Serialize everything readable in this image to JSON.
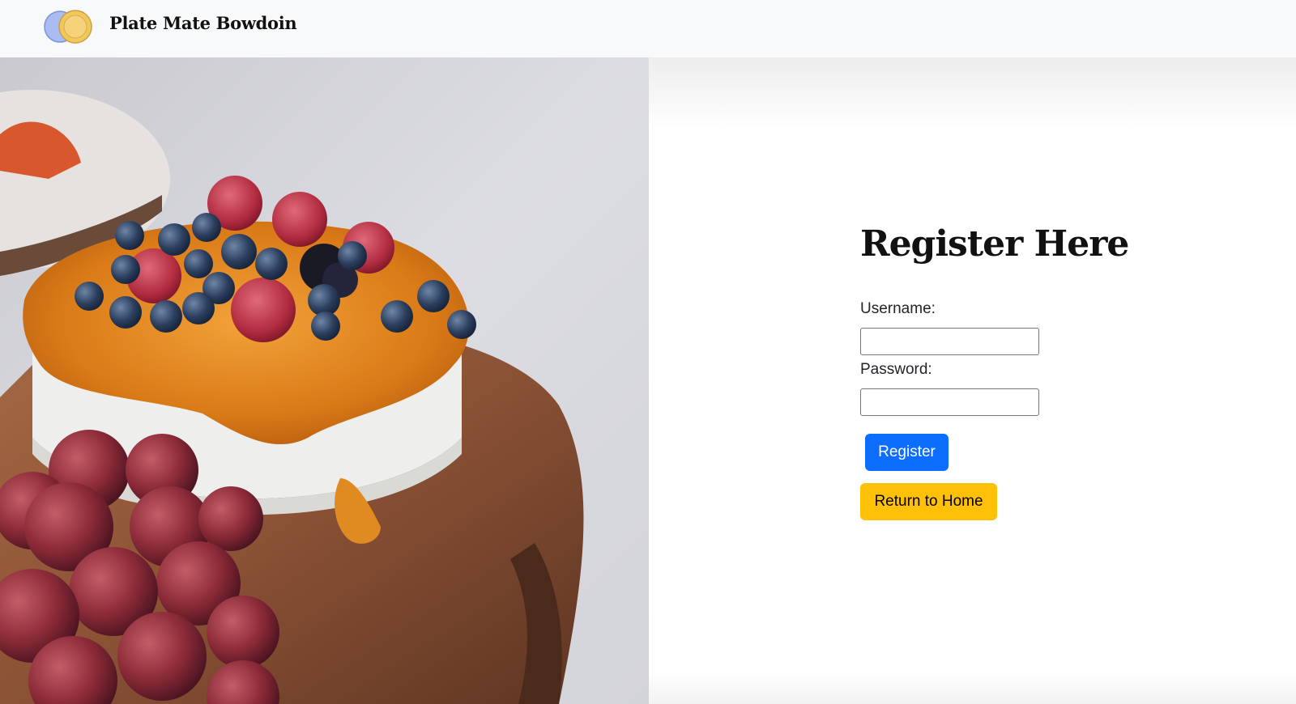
{
  "navbar": {
    "brand": "Plate Mate Bowdoin",
    "logo_icon": "plates-logo-icon"
  },
  "hero": {
    "image_icon": "dessert-photo"
  },
  "form": {
    "title": "Register Here",
    "username_label": "Username:",
    "username_value": "",
    "password_label": "Password:",
    "password_value": "",
    "register_label": "Register",
    "home_label": "Return to Home"
  },
  "colors": {
    "primary": "#0d6efd",
    "warning": "#ffc107",
    "navbar_bg": "#f8f9fa"
  }
}
